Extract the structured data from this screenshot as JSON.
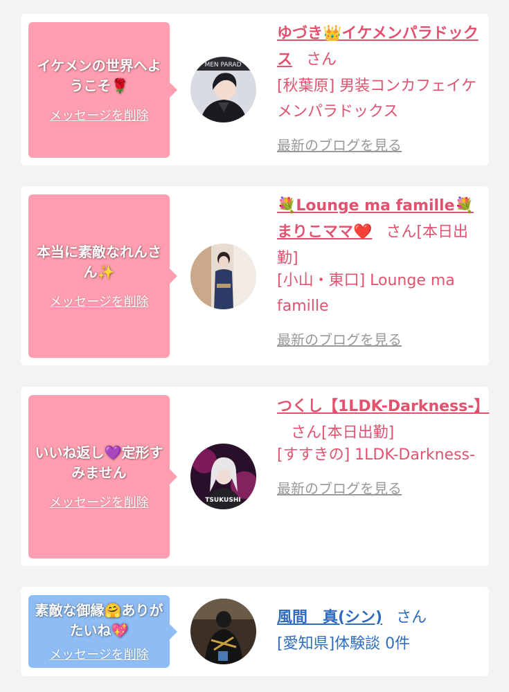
{
  "cards": [
    {
      "message": "イケメンの世界へようこそ🌹",
      "delete_label": "メッセージを削除",
      "name": "ゆづき👑イケメンパラドックス",
      "honorific": "さん",
      "status": "",
      "shop": "[秋葉原] 男装コンカフェイケメンパラドックス",
      "blog_link": "最新のブログを見る",
      "bubble_color": "pink",
      "avatar_caption": "MEN PARAD"
    },
    {
      "message": "本当に素敵なれんさん✨",
      "delete_label": "メッセージを削除",
      "name": "💐Lounge ma famille💐まりこママ❤️",
      "honorific": "さん",
      "status": "[本日出勤]",
      "shop": "[小山・東口] Lounge ma famille",
      "blog_link": "最新のブログを見る",
      "bubble_color": "pink"
    },
    {
      "message": "いいね返し💜定形すみません",
      "delete_label": "メッセージを削除",
      "name": "つくし【1LDK-Darkness-】",
      "honorific": "さん",
      "status": "[本日出勤]",
      "shop": "[すすきの] 1LDK-Darkness-",
      "blog_link": "最新のブログを見る",
      "bubble_color": "pink",
      "avatar_caption": "TSUKUSHI"
    },
    {
      "message": "素敵な御縁🤗ありがたいね💖",
      "delete_label": "メッセージを削除",
      "name": "風間　真(シン)",
      "honorific": "さん",
      "status": "",
      "shop": "[愛知県]体験談 0件",
      "bubble_color": "blue"
    }
  ],
  "colors": {
    "bubble_pink": "#ff9eb0",
    "bubble_blue": "#8ebdf6",
    "name_pink": "#e2526f",
    "name_blue": "#2f6cc0",
    "link_gray": "#999999"
  }
}
